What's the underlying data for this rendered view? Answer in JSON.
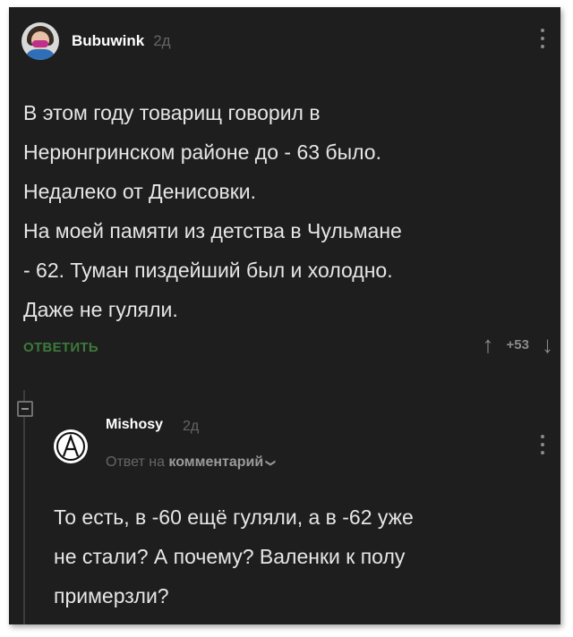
{
  "comment1": {
    "author": "Bubuwink",
    "time": "2д",
    "lines": [
      "В этом году товарищ говорил в",
      "Нерюнгринском районе до - 63 было.",
      "Недалеко от Денисовки.",
      "На моей памяти из детства в Чульмане",
      "- 62. Туман пиздейший был и холодно.",
      "Даже не гуляли."
    ],
    "reply_label": "ОТВЕТИТЬ",
    "rating": "+53",
    "upvote_icon": "arrow-up-icon",
    "downvote_icon": "arrow-down-icon"
  },
  "comment2": {
    "author": "Mishosy",
    "time": "2д",
    "reply_prefix": "Ответ на",
    "reply_target": "комментарий",
    "lines": [
      "То есть, в -60 ещё гуляли, а в -62 уже",
      "не стали? А почему? Валенки к полу",
      "примерзли?"
    ]
  }
}
